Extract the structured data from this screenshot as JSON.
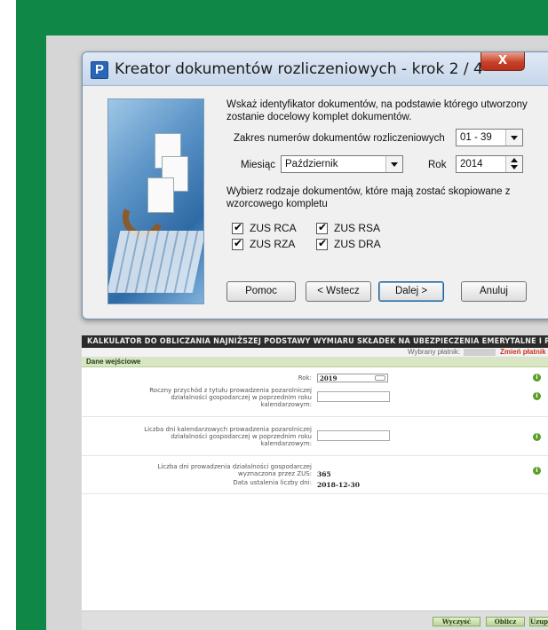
{
  "wizard": {
    "title": "Kreator dokumentów rozliczeniowych - krok 2 / 4",
    "app_icon_letter": "P",
    "close_label": "X",
    "instruction": "Wskaż identyfikator dokumentów, na podstawie którego utworzony zostanie docelowy komplet dokumentów.",
    "range_label": "Zakres numerów dokumentów rozliczeniowych",
    "range_value": "01 - 39",
    "month_label": "Miesiąc",
    "month_value": "Październik",
    "year_label": "Rok",
    "year_value": "2014",
    "types_instruction": "Wybierz rodzaje dokumentów, które mają zostać skopiowane z wzorcowego kompletu",
    "checkboxes": [
      {
        "label": "ZUS RCA",
        "checked": true
      },
      {
        "label": "ZUS RSA",
        "checked": true
      },
      {
        "label": "ZUS RZA",
        "checked": true
      },
      {
        "label": "ZUS DRA",
        "checked": true
      }
    ],
    "buttons": {
      "help": "Pomoc",
      "back": "< Wstecz",
      "next": "Dalej >",
      "cancel": "Anuluj"
    }
  },
  "calculator": {
    "header": "KALKULATOR DO OBLICZANIA NAJNIŻSZEJ PODSTAWY WYMIARU SKŁADEK NA UBEZPIECZENIA EMERYTALNE I RENTOWE",
    "payer_label": "Wybrany płatnik:",
    "change_payer": "Zmień płatnik",
    "section_title": "Dane wejściowe",
    "year_label": "Rok:",
    "year_value": "2019",
    "income_label": "Roczny przychód z tytułu prowadzenia pozarolniczej działalności gospodarczej w poprzednim roku kalendarzowym:",
    "days_label": "Liczba dni kalendarzowych prowadzenia pozarolniczej działalności gospodarczej w poprzednim roku kalendarzowym:",
    "zus_days_label": "Liczba dni prowadzenia działalności gospodarczej wyznaczona przez ZUS:",
    "zus_days_value": "365",
    "date_label": "Data ustalenia liczby dni:",
    "date_value": "2018-12-30",
    "info_glyph": "i",
    "buttons": {
      "clear": "Wyczyść",
      "calculate": "Oblicz",
      "fill": "Uzupełnij"
    }
  },
  "colors": {
    "green_panel": "#0e8747",
    "close_button": "#c8422a",
    "section_bar": "#d8e6c2",
    "change_payer": "#c9331e"
  }
}
